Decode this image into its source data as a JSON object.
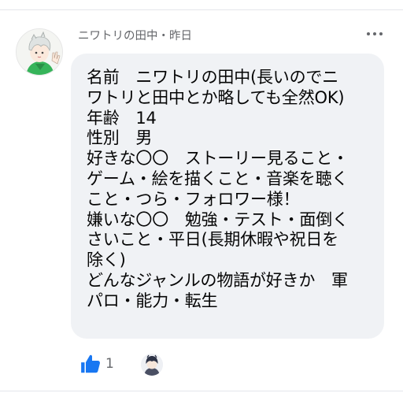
{
  "post": {
    "author": "ニワトリの田中",
    "separator": "・",
    "time": "昨日",
    "body_lines": [
      "名前　ニワトリの田中(長いのでニ",
      "ワトリと田中とか略しても全然OK)",
      "年齢　14",
      "性別　男",
      "好きな〇〇　ストーリー見ること・",
      "ゲーム・絵を描くこと・音楽を聴く",
      "こと・つら・フォロワー様！",
      "嫌いな〇〇　勉強・テスト・面倒く",
      "さいこと・平日(長期休暇や祝日を",
      "除く)",
      "どんなジャンルの物語が好きか　軍",
      "パロ・能力・転生"
    ]
  },
  "reactions": {
    "like_count": "1",
    "like_icon": "thumbs-up-icon"
  },
  "icons": {
    "more": "more-horizontal-icon"
  },
  "colors": {
    "like_blue": "#1877f2",
    "bubble_bg": "#f0f2f5",
    "meta_gray": "#65676b",
    "avatar_shirt_green": "#36b45a"
  }
}
